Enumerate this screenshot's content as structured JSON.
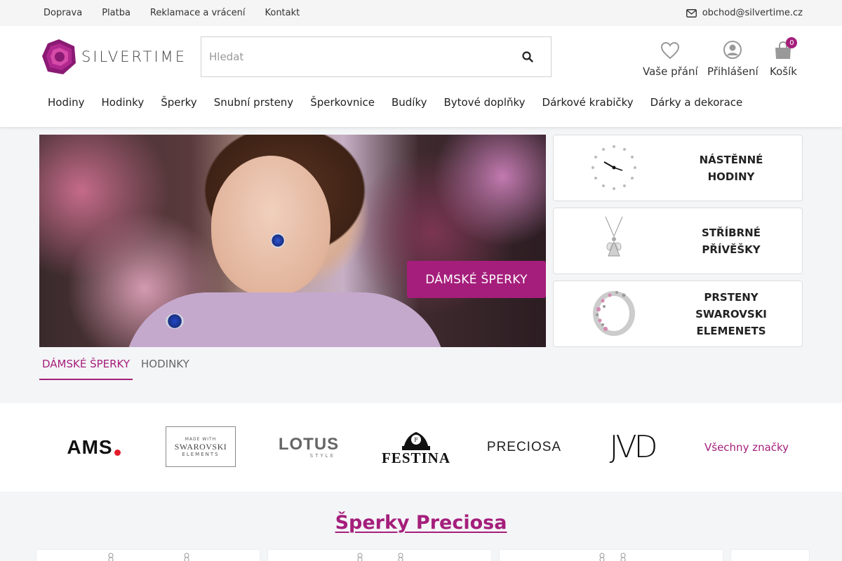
{
  "topbar": {
    "links": [
      "Doprava",
      "Platba",
      "Reklamace a vrácení",
      "Kontakt"
    ],
    "email": "obchod@silvertime.cz",
    "email_icon": "mail-icon"
  },
  "header": {
    "logo_text": "SILVERTIME",
    "search_placeholder": "Hledat",
    "search_icon": "search-icon",
    "wishlist_label": "Vaše přání",
    "login_label": "Přihlášení",
    "cart_label": "Košík",
    "cart_count": "0"
  },
  "nav": [
    "Hodiny",
    "Hodinky",
    "Šperky",
    "Snubní prsteny",
    "Šperkovnice",
    "Budíky",
    "Bytové doplňky",
    "Dárkové krabičky",
    "Dárky a dekorace"
  ],
  "hero": {
    "cta_label": "DÁMSKÉ ŠPERKY",
    "tabs": [
      "DÁMSKÉ ŠPERKY",
      "HODINKY"
    ],
    "active_tab": 0
  },
  "categories": [
    {
      "line1": "NÁSTĚNNÉ",
      "line2": "HODINY",
      "line3": ""
    },
    {
      "line1": "STŘÍBRNÉ",
      "line2": "PŘÍVĚŠKY",
      "line3": ""
    },
    {
      "line1": "PRSTENY",
      "line2": "SWAROVSKI",
      "line3": "ELEMENETS"
    }
  ],
  "brands": {
    "ams": "AMS",
    "swarovski_top": "MADE WITH",
    "swarovski_mid": "SWAROVSKI",
    "swarovski_bot": "ELEMENTS",
    "lotus": "LOTUS",
    "lotus_sub": "STYLE",
    "festina": "FESTINA",
    "preciosa": "PRECIOSA",
    "jvd": "JVD",
    "all_label": "Všechny značky"
  },
  "section": {
    "title": "Šperky Preciosa"
  },
  "colors": {
    "brand": "#a51e7b",
    "text": "#222222",
    "topbar_bg": "#f5f5f5"
  }
}
